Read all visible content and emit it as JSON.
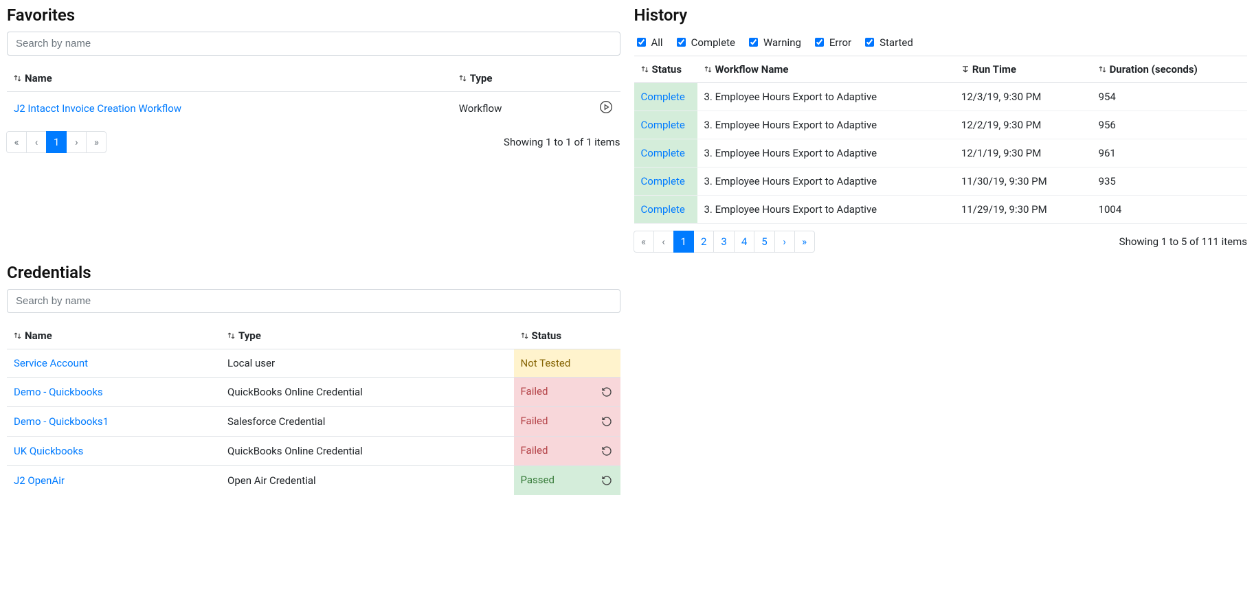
{
  "favorites": {
    "heading": "Favorites",
    "search_placeholder": "Search by name",
    "columns": {
      "name": "Name",
      "type": "Type"
    },
    "rows": [
      {
        "name": "J2 Intacct Invoice Creation Workflow",
        "type": "Workflow"
      }
    ],
    "pager": {
      "first": "«",
      "prev": "‹",
      "next": "›",
      "last": "»",
      "pages": [
        "1"
      ],
      "active": "1"
    },
    "summary": "Showing 1 to 1 of 1 items"
  },
  "credentials": {
    "heading": "Credentials",
    "search_placeholder": "Search by name",
    "columns": {
      "name": "Name",
      "type": "Type",
      "status": "Status"
    },
    "rows": [
      {
        "name": "Service Account",
        "type": "Local user",
        "status": "Not Tested",
        "statusClass": "not-tested",
        "refresh": false
      },
      {
        "name": "Demo - Quickbooks",
        "type": "QuickBooks Online Credential",
        "status": "Failed",
        "statusClass": "failed",
        "refresh": true
      },
      {
        "name": "Demo - Quickbooks1",
        "type": "Salesforce Credential",
        "status": "Failed",
        "statusClass": "failed",
        "refresh": true
      },
      {
        "name": "UK Quickbooks",
        "type": "QuickBooks Online Credential",
        "status": "Failed",
        "statusClass": "failed",
        "refresh": true
      },
      {
        "name": "J2 OpenAir",
        "type": "Open Air Credential",
        "status": "Passed",
        "statusClass": "passed",
        "refresh": true
      }
    ]
  },
  "history": {
    "heading": "History",
    "filters": [
      "All",
      "Complete",
      "Warning",
      "Error",
      "Started"
    ],
    "columns": {
      "status": "Status",
      "workflow": "Workflow Name",
      "runtime": "Run Time",
      "duration": "Duration (seconds)"
    },
    "rows": [
      {
        "status": "Complete",
        "workflow": "3. Employee Hours Export to Adaptive",
        "runtime": "12/3/19, 9:30 PM",
        "duration": "954"
      },
      {
        "status": "Complete",
        "workflow": "3. Employee Hours Export to Adaptive",
        "runtime": "12/2/19, 9:30 PM",
        "duration": "956"
      },
      {
        "status": "Complete",
        "workflow": "3. Employee Hours Export to Adaptive",
        "runtime": "12/1/19, 9:30 PM",
        "duration": "961"
      },
      {
        "status": "Complete",
        "workflow": "3. Employee Hours Export to Adaptive",
        "runtime": "11/30/19, 9:30 PM",
        "duration": "935"
      },
      {
        "status": "Complete",
        "workflow": "3. Employee Hours Export to Adaptive",
        "runtime": "11/29/19, 9:30 PM",
        "duration": "1004"
      }
    ],
    "pager": {
      "first": "«",
      "prev": "‹",
      "next": "›",
      "last": "»",
      "pages": [
        "1",
        "2",
        "3",
        "4",
        "5"
      ],
      "active": "1"
    },
    "summary": "Showing 1 to 5 of 111 items"
  }
}
